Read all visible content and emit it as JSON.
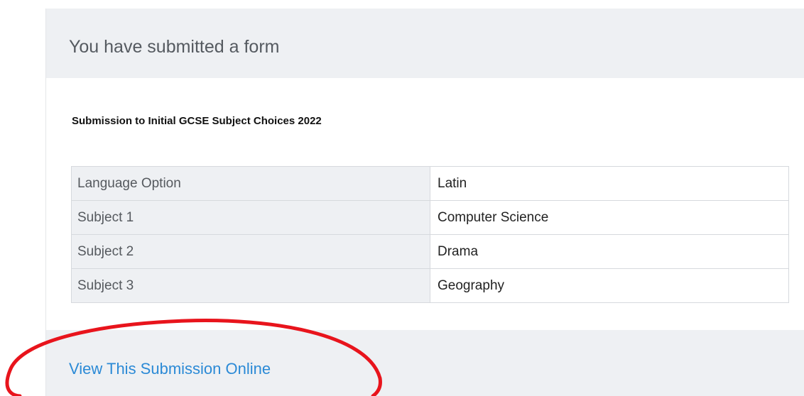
{
  "header": {
    "title": "You have submitted a form"
  },
  "form": {
    "title": "Submission to Initial GCSE Subject Choices 2022",
    "rows": [
      {
        "field": "Language Option",
        "value": "Latin"
      },
      {
        "field": "Subject 1",
        "value": "Computer Science"
      },
      {
        "field": "Subject 2",
        "value": "Drama"
      },
      {
        "field": "Subject 3",
        "value": "Geography"
      }
    ]
  },
  "footer": {
    "link_label": "View This Submission Online"
  },
  "colors": {
    "header_bg": "#eef0f3",
    "link": "#2b8ad6",
    "annotation": "#e8141c"
  }
}
